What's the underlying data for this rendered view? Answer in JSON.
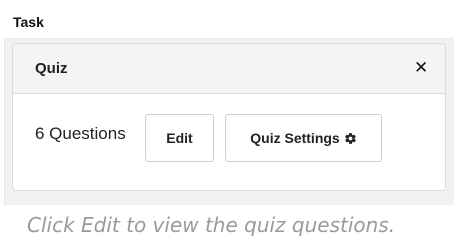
{
  "section": {
    "label": "Task"
  },
  "quiz_card": {
    "title": "Quiz",
    "close_icon": "close-icon",
    "question_count": "6 Questions",
    "edit_label": "Edit",
    "settings_label": "Quiz Settings",
    "settings_icon": "gear-icon"
  },
  "hint": "Click Edit to view the quiz questions."
}
